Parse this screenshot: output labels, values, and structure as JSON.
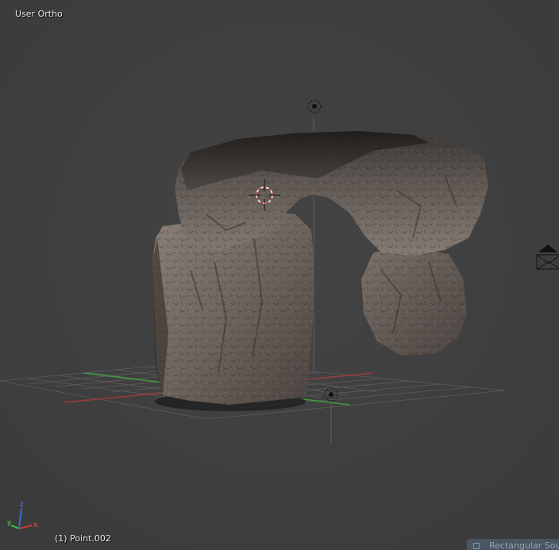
{
  "viewport": {
    "view_label": "User Ortho",
    "object_label": "(1) Point.002",
    "status_tab_label": "Rectangular Sou",
    "background_color": "#3f3f3f",
    "grid_color": "#5a5a5a",
    "x_axis_color": "#a33a3a",
    "y_axis_color": "#3fa33f",
    "rock_color": "#6f655e"
  },
  "gizmo": {
    "x_label": "x",
    "y_label": "y",
    "z_label": "z"
  },
  "icons": {
    "light_top": "point-light-icon",
    "light_bottom": "point-light-icon",
    "cursor": "3d-cursor-icon",
    "camera": "camera-icon"
  }
}
